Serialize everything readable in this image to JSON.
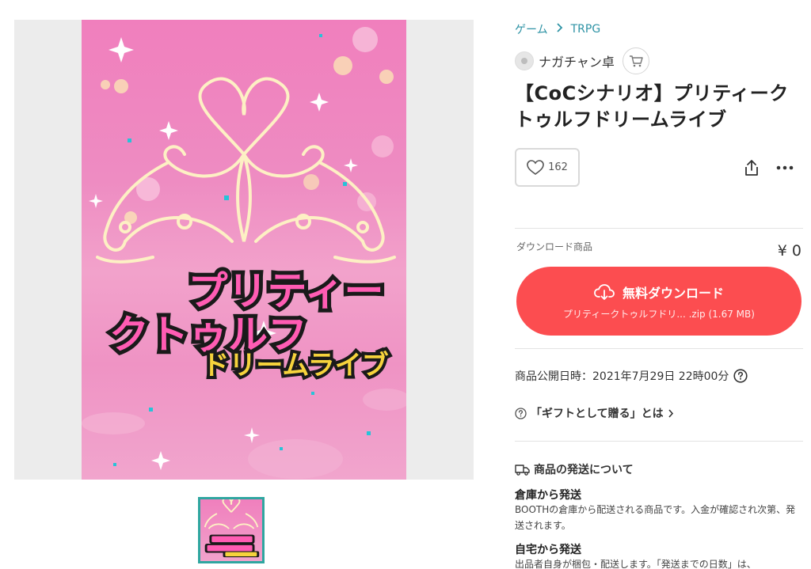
{
  "breadcrumb": {
    "category": "ゲーム",
    "separator": ">",
    "subcategory": "TRPG"
  },
  "shop": {
    "name": "ナガチャン卓"
  },
  "product": {
    "title": "【CoCシナリオ】プリティークトゥルフドリームライブ",
    "likes": "162",
    "download_type_label": "ダウンロード商品",
    "price": "¥ 0",
    "download_button_label": "無料ダウンロード",
    "download_file": "プリティークトゥルフドリ... .zip (1.67 MB)",
    "publish_date": "商品公開日時：2021年7月29日 22時00分",
    "gift_link": "「ギフトとして贈る」とは"
  },
  "cover_art": {
    "title_line1": "プリティー",
    "title_line2": "クトゥルフ",
    "title_line3": "ドリームライブ"
  },
  "shipping": {
    "section_title": "商品の発送について",
    "warehouse_title": "倉庫から発送",
    "warehouse_desc": "BOOTHの倉庫から配送される商品です。入金が確認され次第、発送されます。",
    "home_title": "自宅から発送",
    "home_desc": "出品者自身が梱包・配送します。「発送までの日数」は、"
  },
  "colors": {
    "accent_link": "#2e93a5",
    "download_button": "#fc4d50",
    "cover_pink": "#f07fbd",
    "thumb_border": "#2fa6a0"
  },
  "icons": [
    "heart-icon",
    "share-icon",
    "more-icon",
    "cart-icon",
    "cloud-download-icon",
    "help-circle-icon",
    "truck-icon",
    "chevron-right-icon"
  ]
}
